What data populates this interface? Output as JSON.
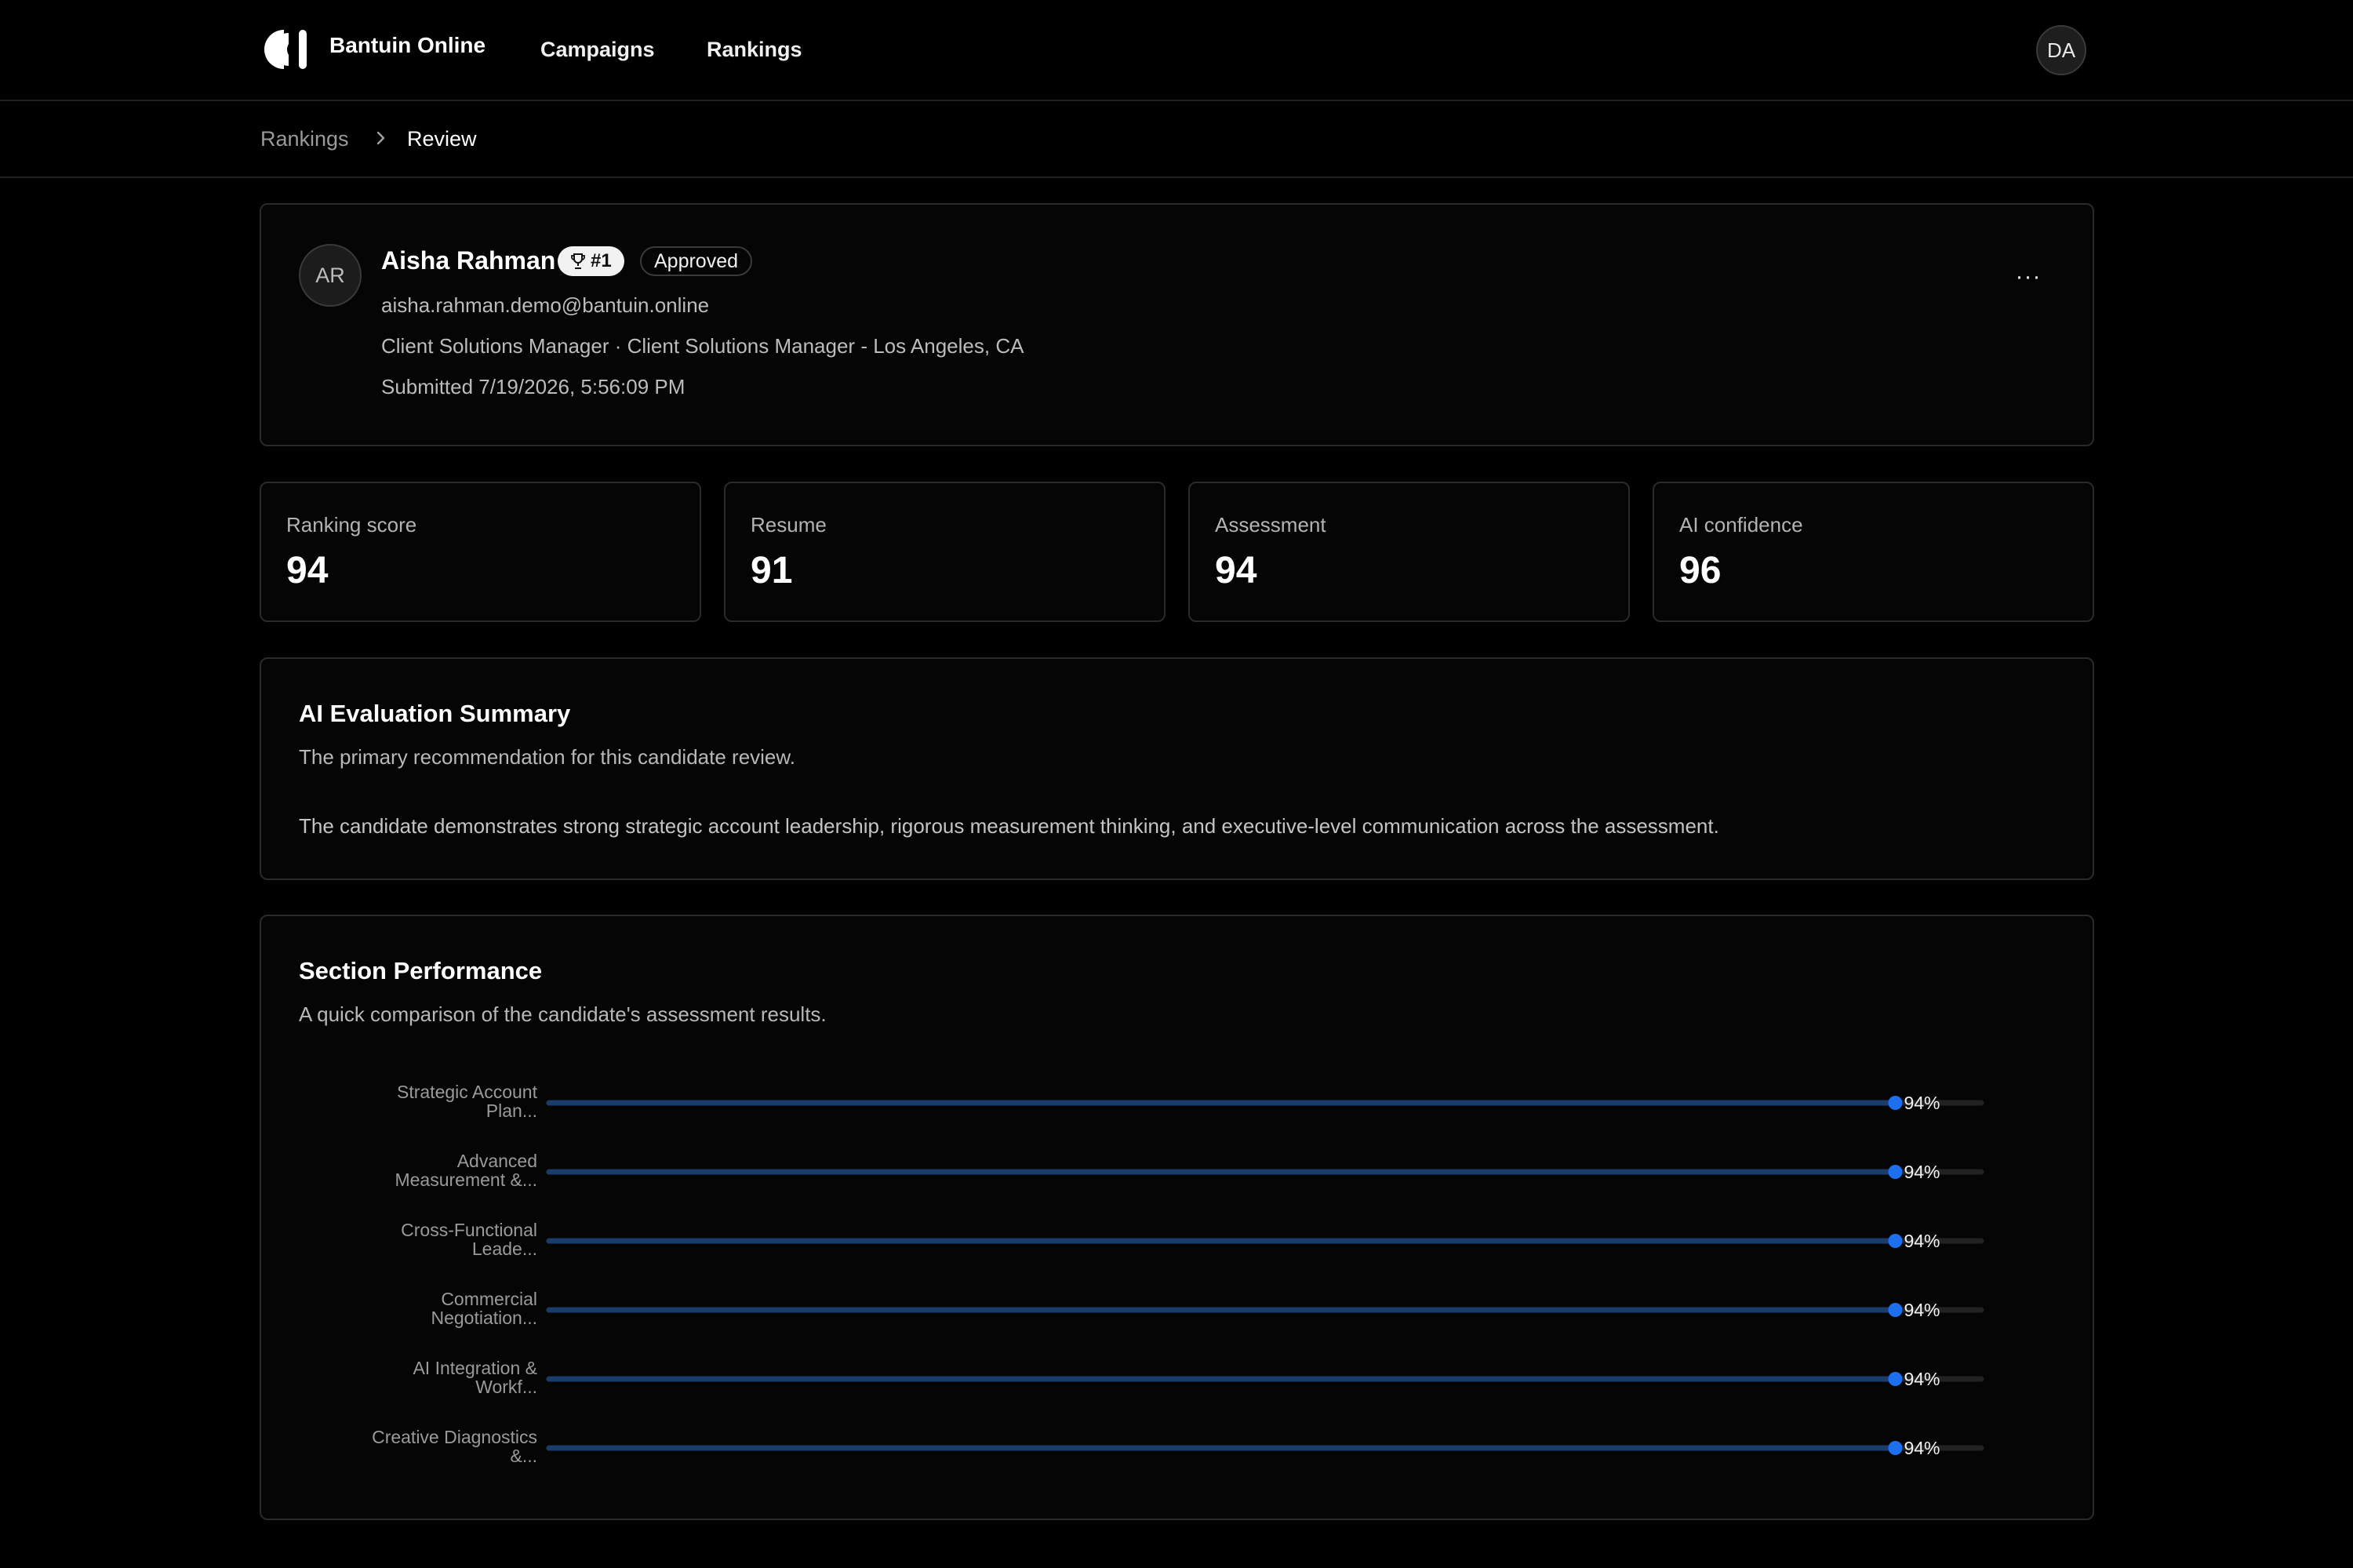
{
  "nav": {
    "brand": "Bantuin Online",
    "links": [
      "Campaigns",
      "Rankings"
    ],
    "user_initials": "DA"
  },
  "breadcrumb": {
    "items": [
      "Rankings",
      "Review"
    ]
  },
  "candidate": {
    "initials": "AR",
    "name": "Aisha Rahman",
    "rank": "#1",
    "status": "Approved",
    "email": "aisha.rahman.demo@bantuin.online",
    "role": "Client Solutions Manager · Client Solutions Manager - Los Angeles, CA",
    "submitted": "Submitted 7/19/2026, 5:56:09 PM",
    "more_label": "···"
  },
  "stats": [
    {
      "label": "Ranking score",
      "value": "94"
    },
    {
      "label": "Resume",
      "value": "91"
    },
    {
      "label": "Assessment",
      "value": "94"
    },
    {
      "label": "AI confidence",
      "value": "96"
    }
  ],
  "summary": {
    "title": "AI Evaluation Summary",
    "subtitle": "The primary recommendation for this candidate review.",
    "body": "The candidate demonstrates strong strategic account leadership, rigorous measurement thinking, and executive-level communication across the assessment."
  },
  "performance": {
    "title": "Section Performance",
    "subtitle": "A quick comparison of the candidate's assessment results."
  },
  "chart_data": {
    "type": "bar",
    "orientation": "horizontal",
    "categories": [
      [
        "Strategic Account",
        "Plan..."
      ],
      [
        "Advanced",
        "Measurement &..."
      ],
      [
        "Cross-Functional",
        "Leade..."
      ],
      [
        "Commercial",
        "Negotiation..."
      ],
      [
        "AI Integration &",
        "Workf..."
      ],
      [
        "Creative Diagnostics",
        "&..."
      ]
    ],
    "values": [
      94,
      94,
      94,
      94,
      94,
      94
    ],
    "value_labels": [
      "94%",
      "94%",
      "94%",
      "94%",
      "94%",
      "94%"
    ],
    "xlim": [
      0,
      100
    ],
    "grid": false,
    "colors": {
      "fill": "#1a3c6b",
      "track": "#222222",
      "marker": "#1e6ff0"
    }
  },
  "colors": {
    "background": "#000000",
    "card_border": "#2a2a2a",
    "accent": "#1e6ff0"
  },
  "icons": {
    "logo": "bantuin-logo-icon",
    "breadcrumb_separator": "chevron-right-icon",
    "rank": "trophy-icon",
    "more": "more-horizontal-icon"
  }
}
